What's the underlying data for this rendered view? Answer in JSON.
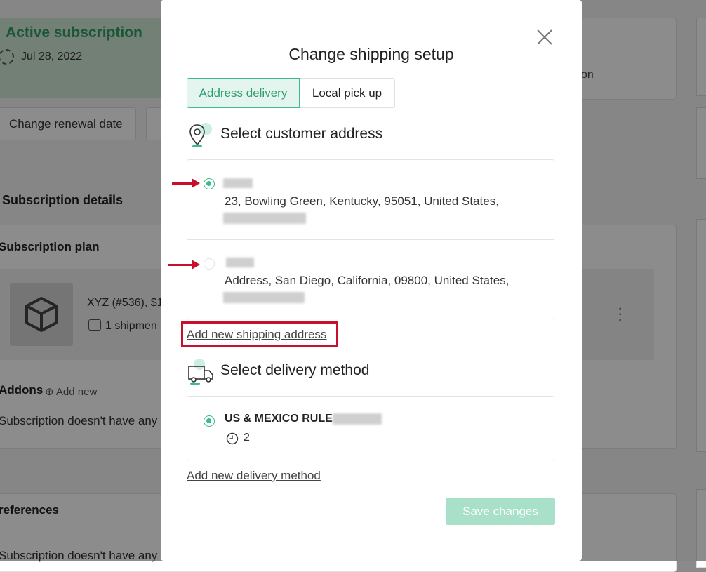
{
  "background": {
    "active_title": "Active subscription",
    "active_date": "Jul 28, 2022",
    "renew_button": "Change renewal date",
    "right_card_text": "on",
    "details_title": "Subscription details",
    "plan_title": "Subscription plan",
    "plan_name": "XYZ (#536), $1",
    "plan_shipments": "1 shipmen",
    "addons_title": "Addons",
    "addons_add": "Add new",
    "no_addons": "Subscription doesn't have any",
    "preferences_title": "references",
    "no_preferences": "Subscription doesn't have any"
  },
  "modal": {
    "title": "Change shipping setup",
    "tabs": [
      {
        "label": "Address delivery",
        "active": true
      },
      {
        "label": "Local pick up",
        "active": false
      }
    ],
    "address_section_title": "Select customer address",
    "addresses": [
      {
        "line": "23, Bowling Green, Kentucky, 95051, United States,",
        "selected": true
      },
      {
        "line": "Address, San Diego, California, 09800, United States,",
        "selected": false
      }
    ],
    "add_address_link": "Add new shipping address",
    "delivery_section_title": "Select delivery method",
    "delivery_methods": [
      {
        "name": "US & MEXICO RULE",
        "days": "2",
        "selected": true
      }
    ],
    "add_delivery_link": "Add new delivery method",
    "save_button": "Save changes"
  },
  "colors": {
    "accent": "#3dbb8a",
    "annotation": "#c8102e",
    "save_disabled": "#a8e0c9"
  },
  "icons": [
    "calendar-icon",
    "box-icon",
    "shipment-icon",
    "kebab-menu-icon",
    "plus-circle-icon",
    "close-icon",
    "location-pin-icon",
    "delivery-truck-icon",
    "clock-icon"
  ]
}
